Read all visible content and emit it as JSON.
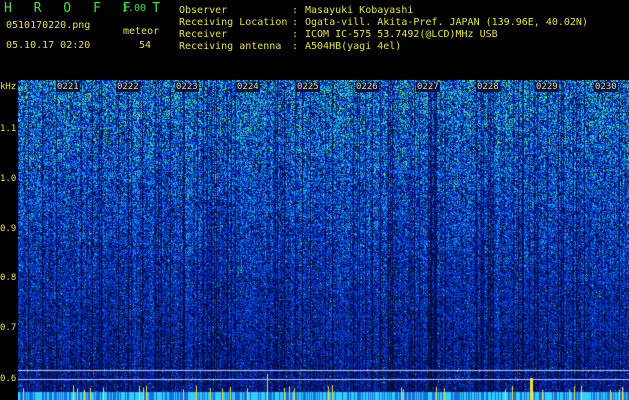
{
  "header": {
    "title": "H R O F F T",
    "version": "1.00",
    "filename": "0510170220.png",
    "datetime": "05.10.17 02:20",
    "meteor_label": "meteor",
    "meteor_count": "54",
    "info": [
      {
        "label": "Observer",
        "sep": ":",
        "value": "Masayuki Kobayashi"
      },
      {
        "label": "Receiving Location",
        "sep": ":",
        "value": "Ogata-vill. Akita-Pref. JAPAN (139.96E, 40.02N)"
      },
      {
        "label": "Receiver",
        "sep": ":",
        "value": "ICOM IC-575 53.7492(@LCD)MHz USB"
      },
      {
        "label": "Receiving antenna",
        "sep": ":",
        "value": "A504HB(yagi 4el)"
      }
    ]
  },
  "axis": {
    "unit": "kHz",
    "freq_ticks": [
      "1.1",
      "1.0",
      "0.9",
      "0.8",
      "0.7",
      "0.6"
    ],
    "freq_range_khz": [
      0.55,
      1.2
    ],
    "time_ticks": [
      "0221",
      "0222",
      "0223",
      "0224",
      "0225",
      "0226",
      "0227",
      "0228",
      "0229",
      "0230"
    ]
  },
  "colors": {
    "background": "#000000",
    "text_yellow": "#e8e23c",
    "title_green": "#3fe04a",
    "noise_dark": "#001a80",
    "noise_mid": "#0048d8",
    "noise_bright": "#20c0ff",
    "signal_green": "#40e080"
  }
}
